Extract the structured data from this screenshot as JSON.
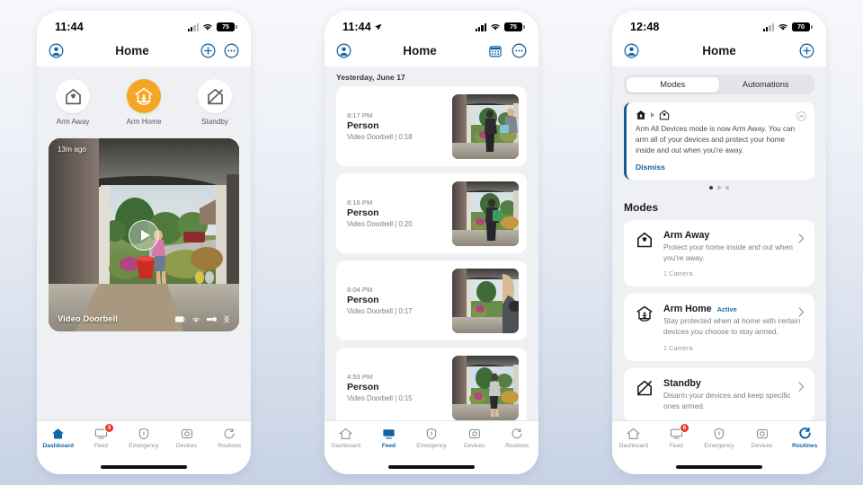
{
  "colors": {
    "accent_blue": "#1264a3",
    "accent_orange": "#f5a623",
    "badge_red": "#e8352a",
    "active_badge_blue": "#1573b8",
    "notif_bar": "#1d5c8e"
  },
  "phone1": {
    "status": {
      "time": "11:44",
      "battery": "75",
      "wifi_icon": "wifi-icon",
      "signal_icon": "cellular-signal-icon",
      "battery_icon": "battery-icon"
    },
    "nav": {
      "title": "Home",
      "profile_icon": "account-circle-icon",
      "add_icon": "plus-circle-icon",
      "more_icon": "more-circle-icon"
    },
    "modes": [
      {
        "label": "Arm Away",
        "icon": "house-shield-icon",
        "active": false
      },
      {
        "label": "Arm Home",
        "icon": "house-person-icon",
        "active": true
      },
      {
        "label": "Standby",
        "icon": "house-slash-icon",
        "active": false
      }
    ],
    "camera_card": {
      "timestamp": "13m ago",
      "device_name": "Video Doorbell",
      "play_icon": "play-button-icon",
      "status_icons": [
        "battery-icon",
        "wifi-icon",
        "signal-icon",
        "link-icon"
      ]
    },
    "tabs": [
      {
        "label": "Dashboard",
        "icon": "home-icon",
        "active": true,
        "badge": ""
      },
      {
        "label": "Feed",
        "icon": "monitor-icon",
        "active": false,
        "badge": "3"
      },
      {
        "label": "Emergency",
        "icon": "shield-icon",
        "active": false,
        "badge": ""
      },
      {
        "label": "Devices",
        "icon": "camera-icon",
        "active": false,
        "badge": ""
      },
      {
        "label": "Routines",
        "icon": "refresh-icon",
        "active": false,
        "badge": ""
      }
    ]
  },
  "phone2": {
    "status": {
      "time": "11:44",
      "battery": "75",
      "location_icon": "location-arrow-icon"
    },
    "nav": {
      "title": "Home",
      "profile_icon": "account-circle-icon",
      "calendar_icon": "calendar-circle-icon",
      "more_icon": "more-circle-icon"
    },
    "date_header": "Yesterday, June 17",
    "events": [
      {
        "time": "8:17 PM",
        "title": "Person",
        "subtitle": "Video Doorbell | 0:18"
      },
      {
        "time": "8:16 PM",
        "title": "Person",
        "subtitle": "Video Doorbell | 0:20"
      },
      {
        "time": "8:04 PM",
        "title": "Person",
        "subtitle": "Video Doorbell | 0:17"
      },
      {
        "time": "4:53 PM",
        "title": "Person",
        "subtitle": "Video Doorbell | 0:15"
      }
    ],
    "tabs": [
      {
        "label": "Dashboard",
        "icon": "home-icon",
        "active": false,
        "badge": ""
      },
      {
        "label": "Feed",
        "icon": "monitor-icon",
        "active": true,
        "badge": ""
      },
      {
        "label": "Emergency",
        "icon": "shield-icon",
        "active": false,
        "badge": ""
      },
      {
        "label": "Devices",
        "icon": "camera-icon",
        "active": false,
        "badge": ""
      },
      {
        "label": "Routines",
        "icon": "refresh-icon",
        "active": false,
        "badge": ""
      }
    ]
  },
  "phone3": {
    "status": {
      "time": "12:48",
      "battery": "70"
    },
    "nav": {
      "title": "Home",
      "profile_icon": "account-circle-icon",
      "add_icon": "plus-circle-icon"
    },
    "segmented": {
      "options": [
        "Modes",
        "Automations"
      ],
      "selected": "Modes"
    },
    "notification": {
      "from_icon": "house-filled-icon",
      "arrow_icon": "arrow-right-icon",
      "to_icon": "house-outline-icon",
      "collapse_icon": "chevron-up-circle-icon",
      "message": "Arm All Devices mode is now Arm Away. You can arm all of your devices and protect your home inside and out when you're away.",
      "dismiss_label": "Dismiss",
      "dots": 3,
      "active_dot": 0
    },
    "section_title": "Modes",
    "mode_cards": [
      {
        "name": "Arm Away",
        "badge": "",
        "description": "Protect your home inside and out when you're away.",
        "meta": "1 Camera",
        "icon": "house-shield-icon",
        "chevron_icon": "chevron-right-icon"
      },
      {
        "name": "Arm Home",
        "badge": "Active",
        "description": "Stay protected when at home with certain devices you choose to stay armed.",
        "meta": "1 Camera",
        "icon": "house-person-icon",
        "chevron_icon": "chevron-right-icon"
      },
      {
        "name": "Standby",
        "badge": "",
        "description": "Disarm your devices and keep specific ones armed.",
        "meta": "",
        "icon": "house-slash-icon",
        "chevron_icon": "chevron-right-icon"
      }
    ],
    "tabs": [
      {
        "label": "Dashboard",
        "icon": "home-icon",
        "active": false,
        "badge": ""
      },
      {
        "label": "Feed",
        "icon": "monitor-icon",
        "active": false,
        "badge": "6"
      },
      {
        "label": "Emergency",
        "icon": "shield-icon",
        "active": false,
        "badge": ""
      },
      {
        "label": "Devices",
        "icon": "camera-icon",
        "active": false,
        "badge": ""
      },
      {
        "label": "Routines",
        "icon": "refresh-icon",
        "active": true,
        "badge": ""
      }
    ]
  }
}
